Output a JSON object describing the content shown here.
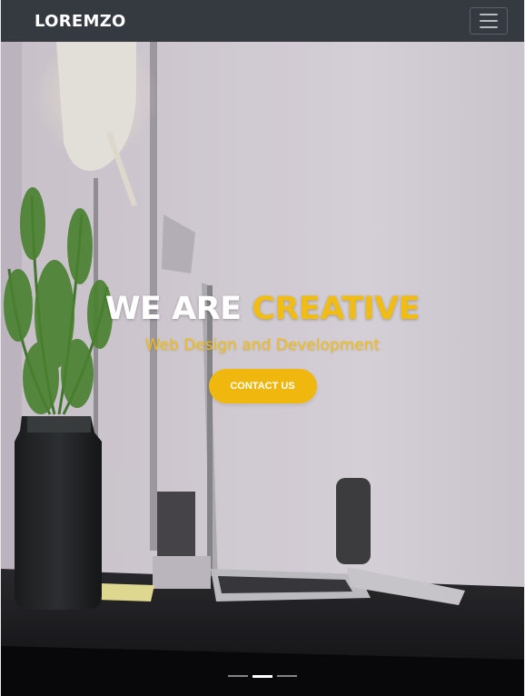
{
  "navbar": {
    "brand": "LOREMZO",
    "toggle_icon": "hamburger-menu-icon"
  },
  "hero": {
    "headline_white": "WE ARE",
    "headline_yellow": "CREATIVE",
    "subtitle": "Web Design and Development",
    "cta_label": "CONTACT US",
    "background_image": "office-desk-with-plant-lamp-laptop"
  },
  "carousel": {
    "slides": 3,
    "active": 2
  },
  "colors": {
    "navbar": "#343a40",
    "accent": "#f1bd12",
    "text_white": "#ffffff"
  }
}
